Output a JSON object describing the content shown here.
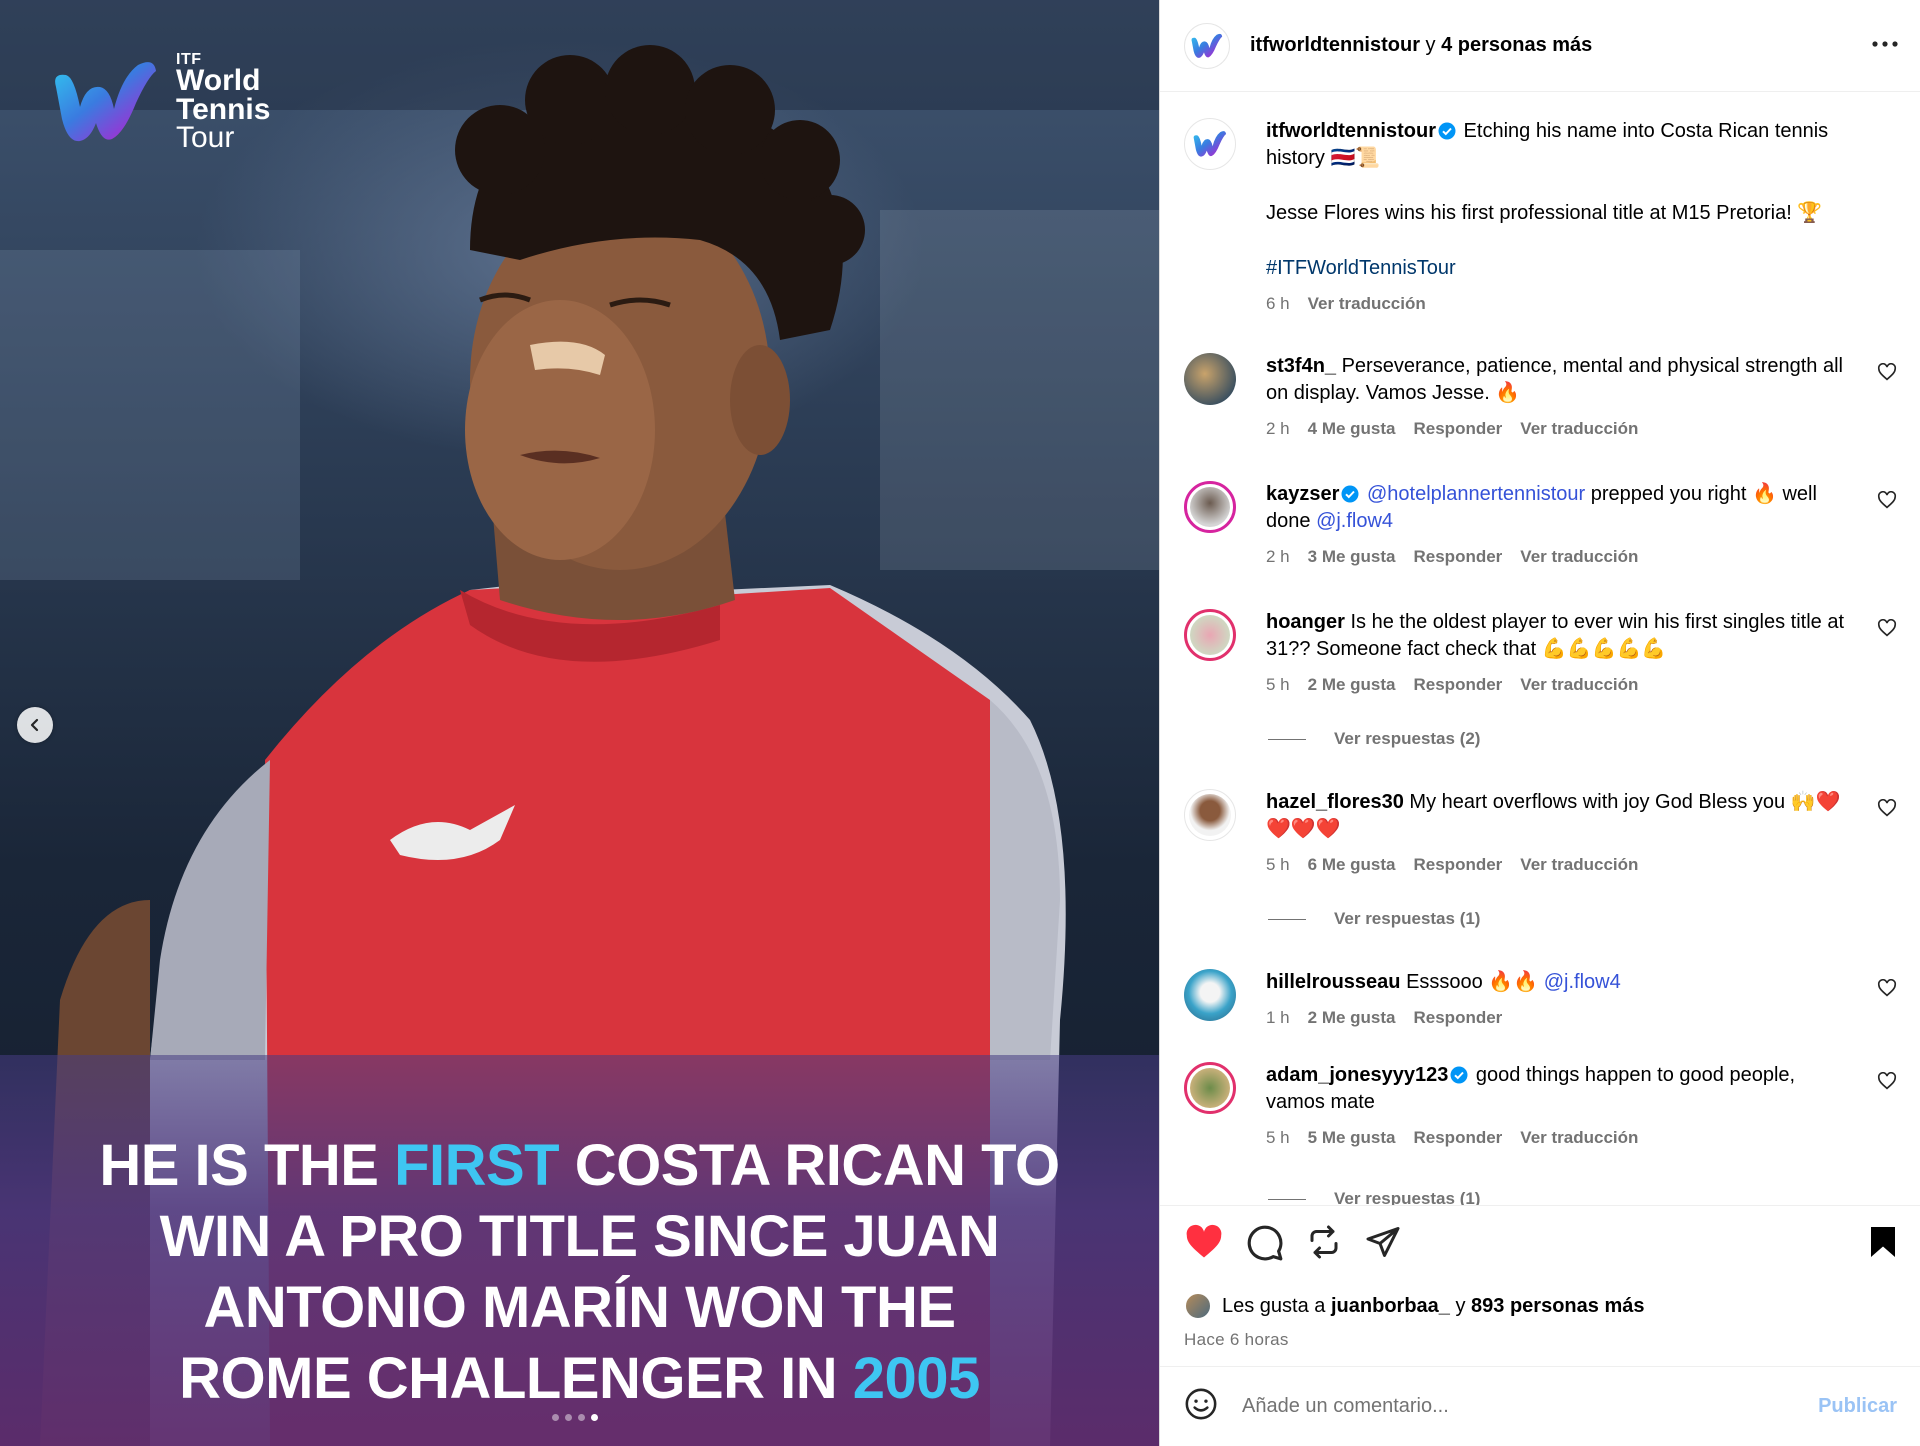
{
  "image": {
    "logo": {
      "itf": "ITF",
      "line1": "World",
      "line2": "Tennis",
      "line3": "Tour"
    },
    "headline": {
      "l1a": "HE IS THE ",
      "l1b": "FIRST",
      "l1c": " COSTA RICAN TO",
      "l2": "WIN A PRO TITLE SINCE JUAN",
      "l3": "ANTONIO MARÍN WON THE",
      "l4a": "ROME CHALLENGER IN ",
      "l4b": "2005"
    },
    "carousel": {
      "total": 4,
      "active": 4
    }
  },
  "header": {
    "username": "itfworldtennistour",
    "connector": "y",
    "others": "4 personas más"
  },
  "caption": {
    "username": "itfworldtennistour",
    "text1": "Etching his name into Costa Rican tennis history 🇨🇷📜",
    "text2": "Jesse Flores wins his first professional title at M15 Pretoria! 🏆",
    "hashtag": "#ITFWorldTennisTour",
    "time": "6 h",
    "translate": "Ver traducción"
  },
  "comments": [
    {
      "user": "st3f4n_",
      "verified": false,
      "text": "Perseverance, patience, mental and physical strength all on display. Vamos Jesse. 🔥",
      "time": "2 h",
      "likes": "4 Me gusta",
      "reply": "Responder",
      "translate": "Ver traducción"
    },
    {
      "user": "kayzser",
      "verified": true,
      "mention1": "@hotelplannertennistour",
      "text_mid": " prepped you right 🔥 well done ",
      "mention2": "@j.flow4",
      "time": "2 h",
      "likes": "3 Me gusta",
      "reply": "Responder",
      "translate": "Ver traducción"
    },
    {
      "user": "hoanger",
      "verified": false,
      "text": "Is he the oldest player to ever win his first singles title at 31?? Someone fact check that 💪💪💪💪💪",
      "time": "5 h",
      "likes": "2 Me gusta",
      "reply": "Responder",
      "translate": "Ver traducción",
      "replies": "Ver respuestas (2)"
    },
    {
      "user": "hazel_flores30",
      "verified": false,
      "text": "My heart overflows with joy God Bless you 🙌❤️❤️❤️❤️",
      "time": "5 h",
      "likes": "6 Me gusta",
      "reply": "Responder",
      "translate": "Ver traducción",
      "replies": "Ver respuestas (1)"
    },
    {
      "user": "hillelrousseau",
      "verified": false,
      "text": "Esssooo 🔥🔥 ",
      "mention": "@j.flow4",
      "time": "1 h",
      "likes": "2 Me gusta",
      "reply": "Responder"
    },
    {
      "user": "adam_jonesyyy123",
      "verified": true,
      "text": "good things happen to good people, vamos mate",
      "time": "5 h",
      "likes": "5 Me gusta",
      "reply": "Responder",
      "translate": "Ver traducción",
      "replies": "Ver respuestas (1)"
    }
  ],
  "likes": {
    "prefix": "Les gusta a",
    "user": "juanborbaa_",
    "connector": "y",
    "count": "893 personas más"
  },
  "timestamp": "Hace 6 horas",
  "add_comment": {
    "placeholder": "Añade un comentario...",
    "publish": "Publicar"
  },
  "colors": {
    "like_red": "#ff3040",
    "link_blue": "#3552d8",
    "headline_cyan": "#3ec6f2"
  }
}
